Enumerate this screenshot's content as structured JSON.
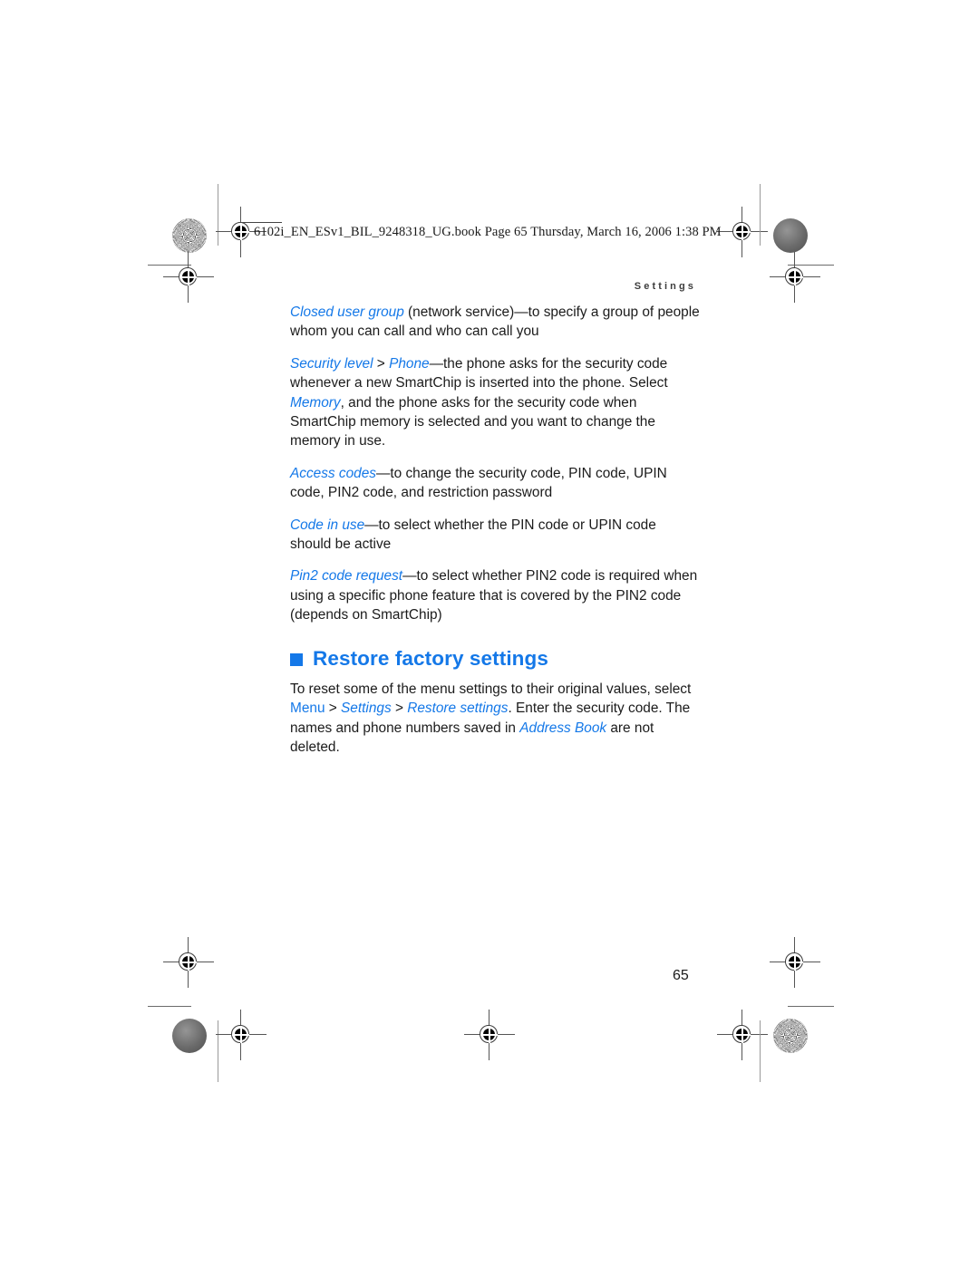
{
  "document": {
    "book_header": "6102i_EN_ESv1_BIL_9248318_UG.book  Page 65  Thursday, March 16, 2006  1:38 PM",
    "running_head": "Settings",
    "page_number": "65",
    "accent_color": "#1478e8",
    "text_color": "#1b1b1b"
  },
  "content": {
    "paragraphs": [
      {
        "id": "closed-user-group",
        "runs": [
          {
            "style": "term",
            "text": "Closed user group"
          },
          {
            "style": "plain",
            "text": " (network service)—to specify a group of people whom you can call and who can call you"
          }
        ]
      },
      {
        "id": "security-level",
        "runs": [
          {
            "style": "term",
            "text": "Security level"
          },
          {
            "style": "plain",
            "text": " > "
          },
          {
            "style": "term",
            "text": "Phone"
          },
          {
            "style": "plain",
            "text": "—the phone asks for the security code whenever a new SmartChip is inserted into the phone. Select "
          },
          {
            "style": "term",
            "text": "Memory"
          },
          {
            "style": "plain",
            "text": ", and the phone asks for the security code when SmartChip memory is selected and you want to change the memory in use."
          }
        ]
      },
      {
        "id": "access-codes",
        "runs": [
          {
            "style": "term",
            "text": "Access codes"
          },
          {
            "style": "plain",
            "text": "—to change the security code, PIN code, UPIN code, PIN2 code, and restriction password"
          }
        ]
      },
      {
        "id": "code-in-use",
        "runs": [
          {
            "style": "term",
            "text": "Code in use"
          },
          {
            "style": "plain",
            "text": "—to select whether the PIN code or UPIN code should be active"
          }
        ]
      },
      {
        "id": "pin2-code-request",
        "runs": [
          {
            "style": "term",
            "text": "Pin2 code request"
          },
          {
            "style": "plain",
            "text": "—to select whether PIN2 code is required when using a specific phone feature that is covered by the PIN2 code (depends on SmartChip)"
          }
        ]
      }
    ],
    "section_heading": {
      "bullet": "square-bullet",
      "title": "Restore factory settings"
    },
    "section_paragraphs": [
      {
        "id": "restore-intro",
        "runs": [
          {
            "style": "plain",
            "text": "To reset some of the menu settings to their original values, select "
          },
          {
            "style": "term-plain",
            "text": "Menu"
          },
          {
            "style": "plain",
            "text": " > "
          },
          {
            "style": "term",
            "text": "Settings"
          },
          {
            "style": "plain",
            "text": " > "
          },
          {
            "style": "term",
            "text": "Restore settings"
          },
          {
            "style": "plain",
            "text": ". Enter the security code. The names and phone numbers saved in "
          },
          {
            "style": "term",
            "text": "Address Book"
          },
          {
            "style": "plain",
            "text": " are not deleted."
          }
        ]
      }
    ]
  }
}
